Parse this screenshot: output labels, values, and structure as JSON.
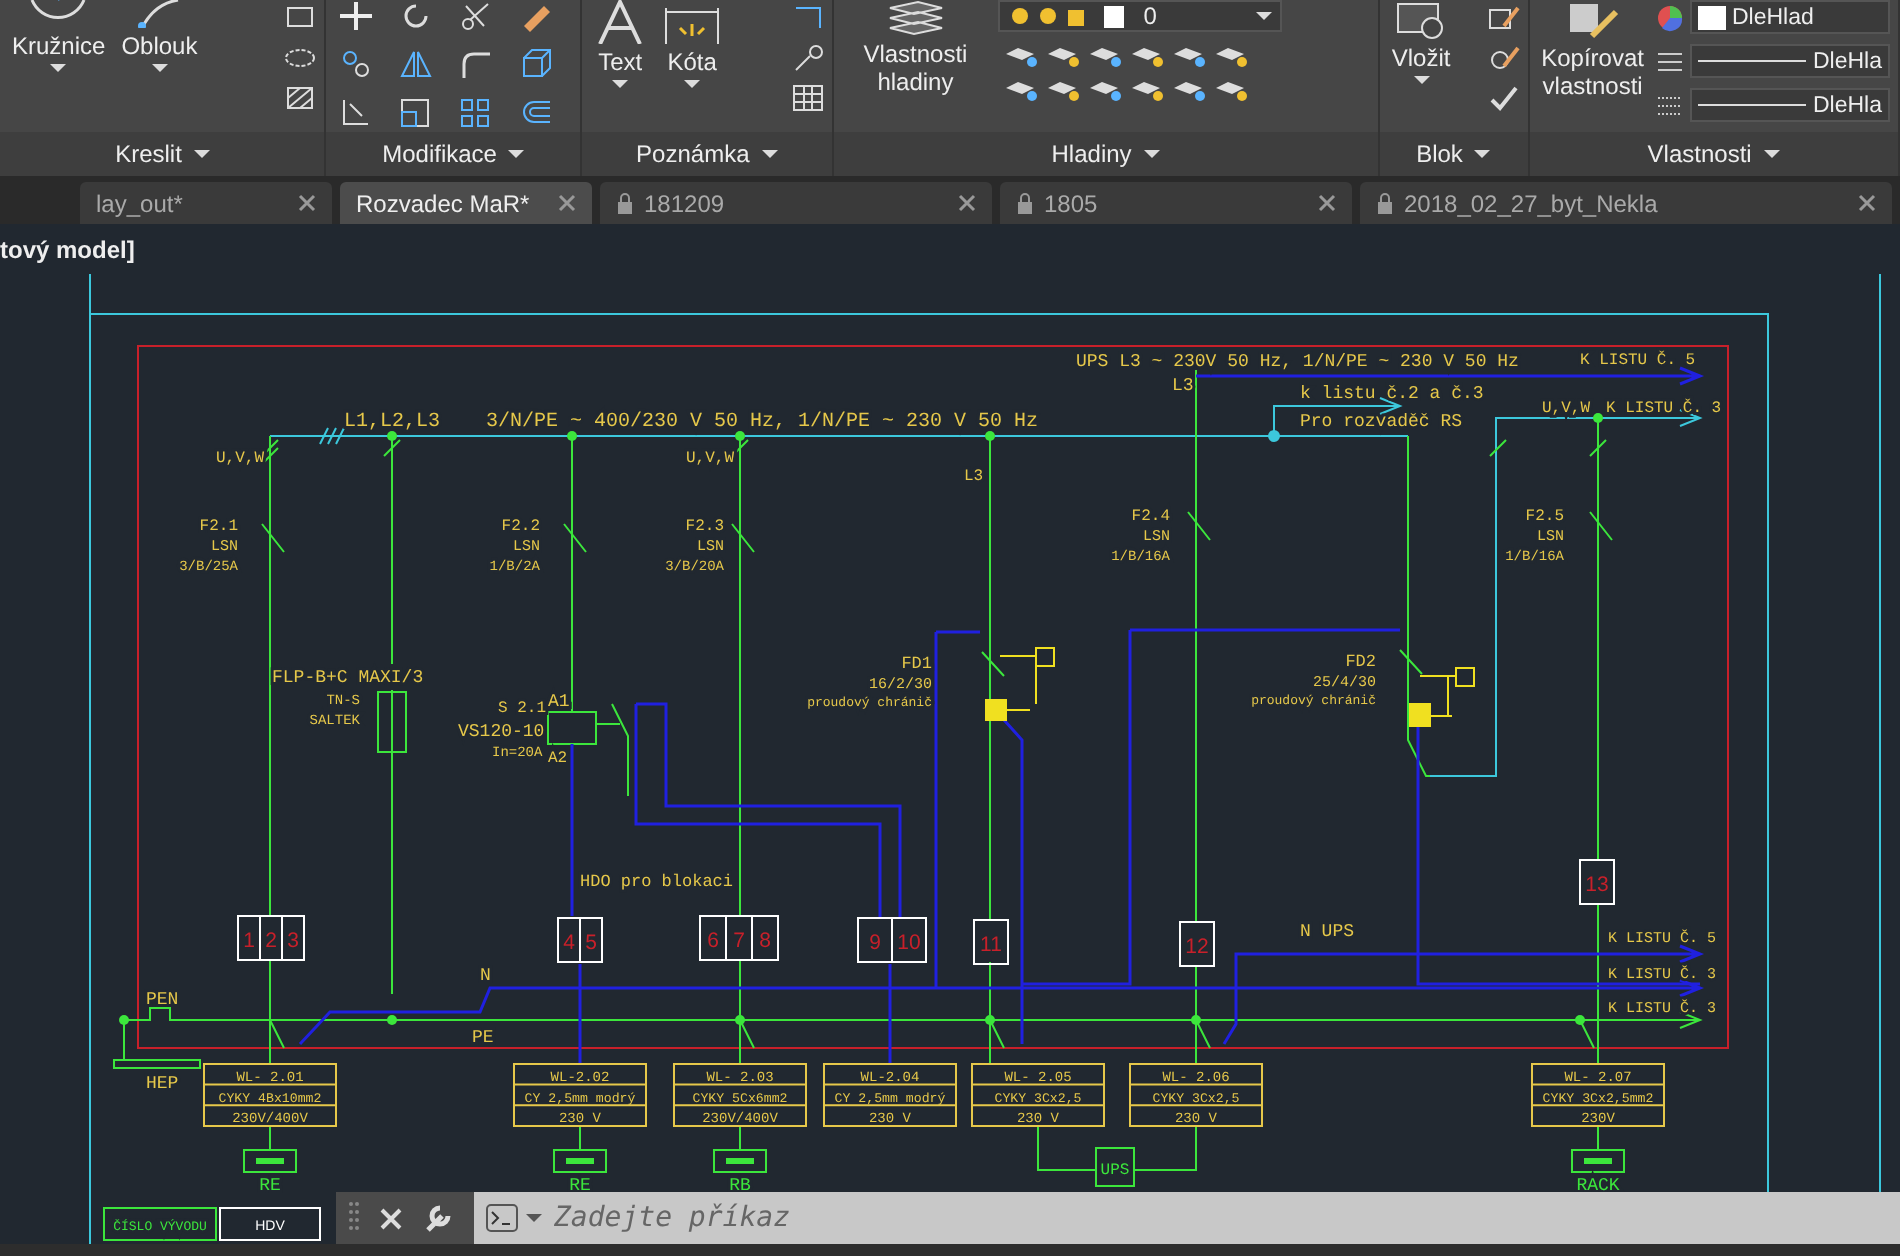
{
  "ribbon": {
    "panels": [
      {
        "title": "Kreslit",
        "tools": [
          {
            "label": "Kružnice"
          },
          {
            "label": "Oblouk"
          }
        ]
      },
      {
        "title": "Modifikace"
      },
      {
        "title": "Poznámka",
        "tools": [
          {
            "label": "Text"
          },
          {
            "label": "Kóta"
          }
        ]
      },
      {
        "title": "Hladiny",
        "tools": [
          {
            "label": "Vlastnosti hladiny"
          }
        ],
        "layer": "0"
      },
      {
        "title": "Blok",
        "tools": [
          {
            "label": "Vložit"
          }
        ]
      },
      {
        "title": "Vlastnosti",
        "tools": [
          {
            "label": "Kopírovat vlastnosti"
          }
        ],
        "properties": [
          "DleHlad",
          "DleHla",
          "DleHla"
        ]
      }
    ]
  },
  "tabs": [
    {
      "label": "lay_out*",
      "selected": false,
      "locked": false
    },
    {
      "label": "Rozvadec MaR*",
      "selected": true,
      "locked": false
    },
    {
      "label": "181209",
      "selected": false,
      "locked": true
    },
    {
      "label": "1805",
      "selected": false,
      "locked": true
    },
    {
      "label": "2018_02_27_byt_Nekla",
      "selected": false,
      "locked": true
    }
  ],
  "viewport_label": "tový model]",
  "schematic": {
    "labels": [
      "L1,L2,L3",
      "3/N/PE ~ 400/230 V 50 Hz, 1/N/PE ~ 230 V 50 Hz",
      "UPS L3 ~ 230V 50 Hz, 1/N/PE ~ 230 V 50 Hz",
      "K LISTU Č. 5",
      "L3",
      "k listu č.2 a č.3",
      "Pro rozvaděč RS",
      "U,V,W",
      "K LISTU Č. 3",
      "U,V,W",
      "U,V,W",
      "L3",
      "FLP-B+C MAXI/3",
      "TN-S",
      "SALTEK",
      "S 2.1",
      "A1",
      "VS120-10",
      "In=20A",
      "A2",
      "HDO pro blokaci",
      "N",
      "PE",
      "PEN",
      "HEP",
      "N UPS",
      "K LISTU Č. 5",
      "K LISTU Č. 3",
      "K LISTU Č. 3"
    ],
    "breakers": [
      {
        "name": "F2.1",
        "type": "LSN",
        "rating": "3/B/25A"
      },
      {
        "name": "F2.2",
        "type": "LSN",
        "rating": "1/B/2A"
      },
      {
        "name": "F2.3",
        "type": "LSN",
        "rating": "3/B/20A"
      },
      {
        "name": "F2.4",
        "type": "LSN",
        "rating": "1/B/16A"
      },
      {
        "name": "F2.5",
        "type": "LSN",
        "rating": "1/B/16A"
      }
    ],
    "rcds": [
      {
        "name": "FD1",
        "rating": "16/2/30",
        "type": "proudový chránič"
      },
      {
        "name": "FD2",
        "rating": "25/4/30",
        "type": "proudový chránič"
      }
    ],
    "terminal_groups": [
      [
        "1",
        "2",
        "3"
      ],
      [
        "4",
        "5"
      ],
      [
        "6",
        "7",
        "8"
      ],
      [
        "9",
        "10"
      ],
      [
        "11"
      ],
      [
        "12"
      ],
      [
        "13"
      ]
    ],
    "cables": [
      {
        "id": "WL- 2.01",
        "type": "CYKY 4Bx10mm2",
        "voltage": "230V/400V"
      },
      {
        "id": "WL-2.02",
        "type": "CY 2,5mm modrý",
        "voltage": "230 V"
      },
      {
        "id": "WL- 2.03",
        "type": "CYKY 5Cx6mm2",
        "voltage": "230V/400V"
      },
      {
        "id": "WL-2.04",
        "type": "CY 2,5mm modrý",
        "voltage": "230 V"
      },
      {
        "id": "WL- 2.05",
        "type": "CYKY 3Cx2,5",
        "voltage": "230 V"
      },
      {
        "id": "WL- 2.06",
        "type": "CYKY 3Cx2,5",
        "voltage": "230 V"
      },
      {
        "id": "WL- 2.07",
        "type": "CYKY 3Cx2,5mm2",
        "voltage": "230V"
      }
    ],
    "loads": [
      "RE",
      "RE",
      "RB",
      "RACK"
    ],
    "ups_label": "UPS",
    "legend": {
      "title": "ČÍSLO VÝVODU",
      "value": "HDV"
    }
  },
  "command_line": {
    "placeholder": "Zadejte příkaz"
  }
}
